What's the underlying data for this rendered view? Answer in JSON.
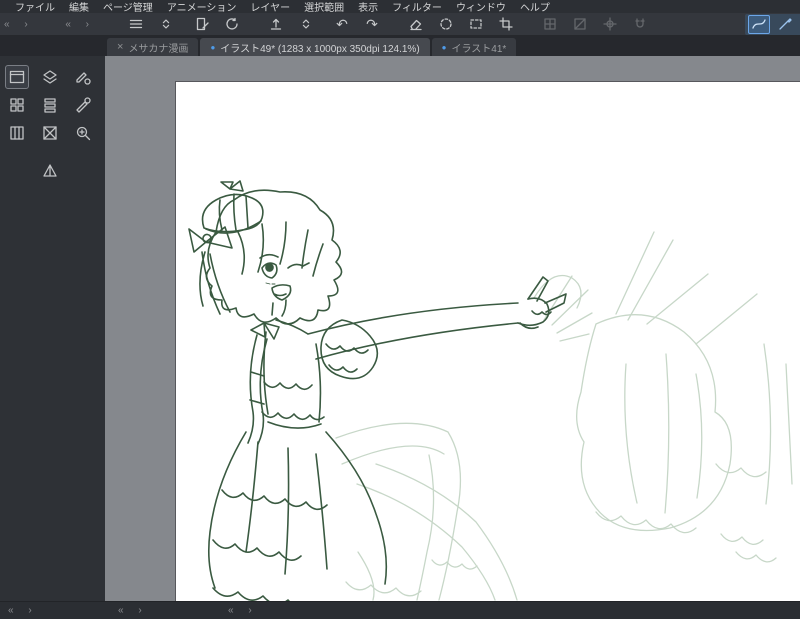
{
  "colors": {
    "accent_blue": "#4f9be8",
    "canvas_line": "#3a5a41",
    "canvas_sketch": "#c7d7c8",
    "canvas_bg": "#ffffff"
  },
  "menu_bar": {
    "items": [
      "ファイル",
      "編集",
      "ページ管理",
      "アニメーション",
      "レイヤー",
      "選択範囲",
      "表示",
      "フィルター",
      "ウィンドウ",
      "ヘルプ"
    ]
  },
  "panel_toggles": {
    "top_left": [
      "« ›",
      "« ›"
    ],
    "bottom": [
      "« ›",
      "« ›",
      "« ›"
    ]
  },
  "toolbar": {
    "undo_glyph": "↶",
    "redo_glyph": "↷",
    "icons": [
      {
        "name": "main-menu"
      },
      {
        "name": "size-stepper"
      },
      {
        "name": "new-page"
      },
      {
        "name": "sync"
      },
      {
        "name": "export"
      },
      {
        "name": "value-stepper"
      },
      {
        "name": "undo"
      },
      {
        "name": "redo"
      },
      {
        "name": "eraser"
      },
      {
        "name": "ellipse-select"
      },
      {
        "name": "rect-marquee"
      },
      {
        "name": "crop"
      },
      {
        "name": "grid",
        "state": "disabled"
      },
      {
        "name": "mesh",
        "state": "disabled"
      },
      {
        "name": "guides",
        "state": "disabled"
      },
      {
        "name": "snap",
        "state": "disabled"
      },
      {
        "name": "curve-pen",
        "state": "selected"
      },
      {
        "name": "straight-pen"
      },
      {
        "name": "fill-pen"
      },
      {
        "name": "brush",
        "state": "dim"
      }
    ]
  },
  "tabs": [
    {
      "close": "×",
      "label": "メサカナ漫画",
      "active": false
    },
    {
      "dot": "●",
      "label": "イラスト49* (1283 x 1000px 350dpi 124.1%)",
      "active": true
    },
    {
      "dot": "●",
      "label": "イラスト41*",
      "active": false
    }
  ],
  "tool_palette": {
    "icons": [
      {
        "name": "tool-window",
        "state": "selected"
      },
      {
        "name": "layer-stack"
      },
      {
        "name": "pen-settings"
      },
      {
        "name": "color-swatches"
      },
      {
        "name": "layer-panels"
      },
      {
        "name": "sub-tool"
      },
      {
        "name": "pattern"
      },
      {
        "name": "clear"
      },
      {
        "name": "zoom"
      },
      {
        "name": "material-ruler"
      }
    ]
  },
  "canvas": {
    "artwork": "anime-girl-lineart"
  }
}
